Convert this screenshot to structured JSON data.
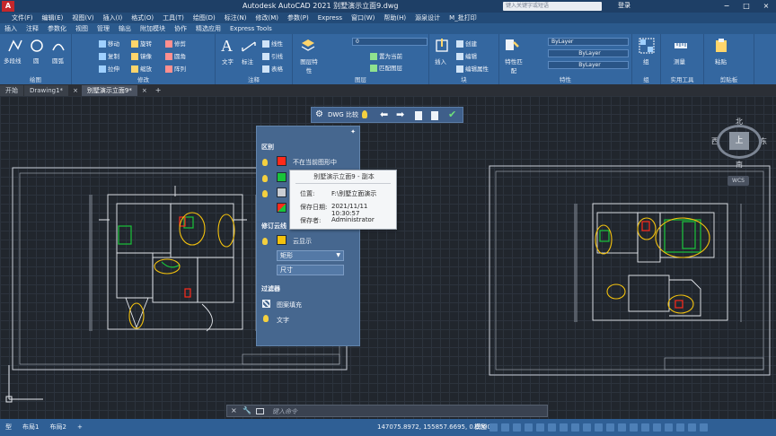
{
  "title_bar": {
    "title": "Autodesk AutoCAD 2021    别墅演示立面9.dwg",
    "search_placeholder": "键入关键字或短语",
    "login": "登录",
    "window_controls": [
      "−",
      "□",
      "×"
    ]
  },
  "menu": [
    "文件(F)",
    "编辑(E)",
    "视图(V)",
    "插入(I)",
    "格式(O)",
    "工具(T)",
    "绘图(D)",
    "标注(N)",
    "修改(M)",
    "参数(P)",
    "Express",
    "窗口(W)",
    "帮助(H)",
    "源泉设计",
    "M_批打印"
  ],
  "ribbon_tabs": [
    "插入",
    "注释",
    "参数化",
    "视图",
    "管理",
    "输出",
    "附加模块",
    "协作",
    "精选应用",
    "Express Tools"
  ],
  "ribbon": {
    "draw": {
      "title": "绘图",
      "polyline": "多段线",
      "circle": "圆",
      "arc": "圆弧"
    },
    "modify": {
      "title": "修改",
      "move": "移动",
      "rotate": "旋转",
      "trim": "修剪",
      "copy": "复制",
      "mirror": "镜像",
      "fillet": "圆角",
      "stretch": "拉伸",
      "scale": "缩放",
      "array": "阵列"
    },
    "annotation": {
      "title": "注释",
      "text": "文字",
      "dimension": "标注",
      "linear": "线性",
      "leader": "引线",
      "table": "表格"
    },
    "layers": {
      "title": "图层",
      "layer_props": "图层特性",
      "current_layer": "0",
      "make_current": "置为当前",
      "match_layer": "匹配图层"
    },
    "block": {
      "title": "块",
      "insert": "插入",
      "create": "创建",
      "edit": "编辑",
      "edit_attr": "编辑属性"
    },
    "properties": {
      "title": "特性",
      "match": "特性匹配",
      "color": "ByLayer",
      "linetype": "ByLayer",
      "lineweight": "ByLayer"
    },
    "groups": {
      "title": "组",
      "group": "组"
    },
    "utilities": {
      "title": "实用工具",
      "measure": "测量"
    },
    "clipboard": {
      "title": "剪贴板",
      "paste": "粘贴"
    }
  },
  "doc_tabs": [
    "开始",
    "Drawing1*",
    "别墅演示立面9*"
  ],
  "dwg_compare": {
    "label": "DWG 比较"
  },
  "compare_panel": {
    "section_diff": "区别",
    "rows": [
      {
        "color": "#ff2a1a",
        "label": "不在当前图形中"
      },
      {
        "color": "#19c43a",
        "label": ""
      },
      {
        "color": "#c9cdd3",
        "label": ""
      },
      {
        "color": "#19c43a",
        "label": ""
      }
    ],
    "section_cloud": "修订云线",
    "cloud_toggle": "云显示",
    "cloud_color": "#f4c20d",
    "shape_value": "矩形",
    "size_label": "尺寸",
    "section_filter": "过滤器",
    "filter_hatch": "图案填充",
    "filter_text": "文字"
  },
  "tooltip": {
    "header": "别墅演示立面9 - 副本",
    "location_label": "位置:",
    "location_value": "F:\\别墅立面演示",
    "date_label": "保存日期:",
    "date_value": "2021/11/11 10:30:57",
    "saver_label": "保存者:",
    "saver_value": "Administrator"
  },
  "viewcube": {
    "north": "北",
    "south": "南",
    "east": "东",
    "west": "西",
    "top": "上",
    "wcs": "WCS"
  },
  "command_line": {
    "placeholder": "键入命令"
  },
  "status_bar": {
    "layout_tabs": [
      "型",
      "布局1",
      "布局2",
      "+"
    ],
    "coords": "147075.8972, 155857.6695, 0.0000",
    "model": "模型"
  },
  "colors": {
    "accent": "#2b5a8d",
    "diff_red": "#ff2a1a",
    "diff_green": "#19c43a",
    "cloud_yellow": "#f4c20d"
  }
}
